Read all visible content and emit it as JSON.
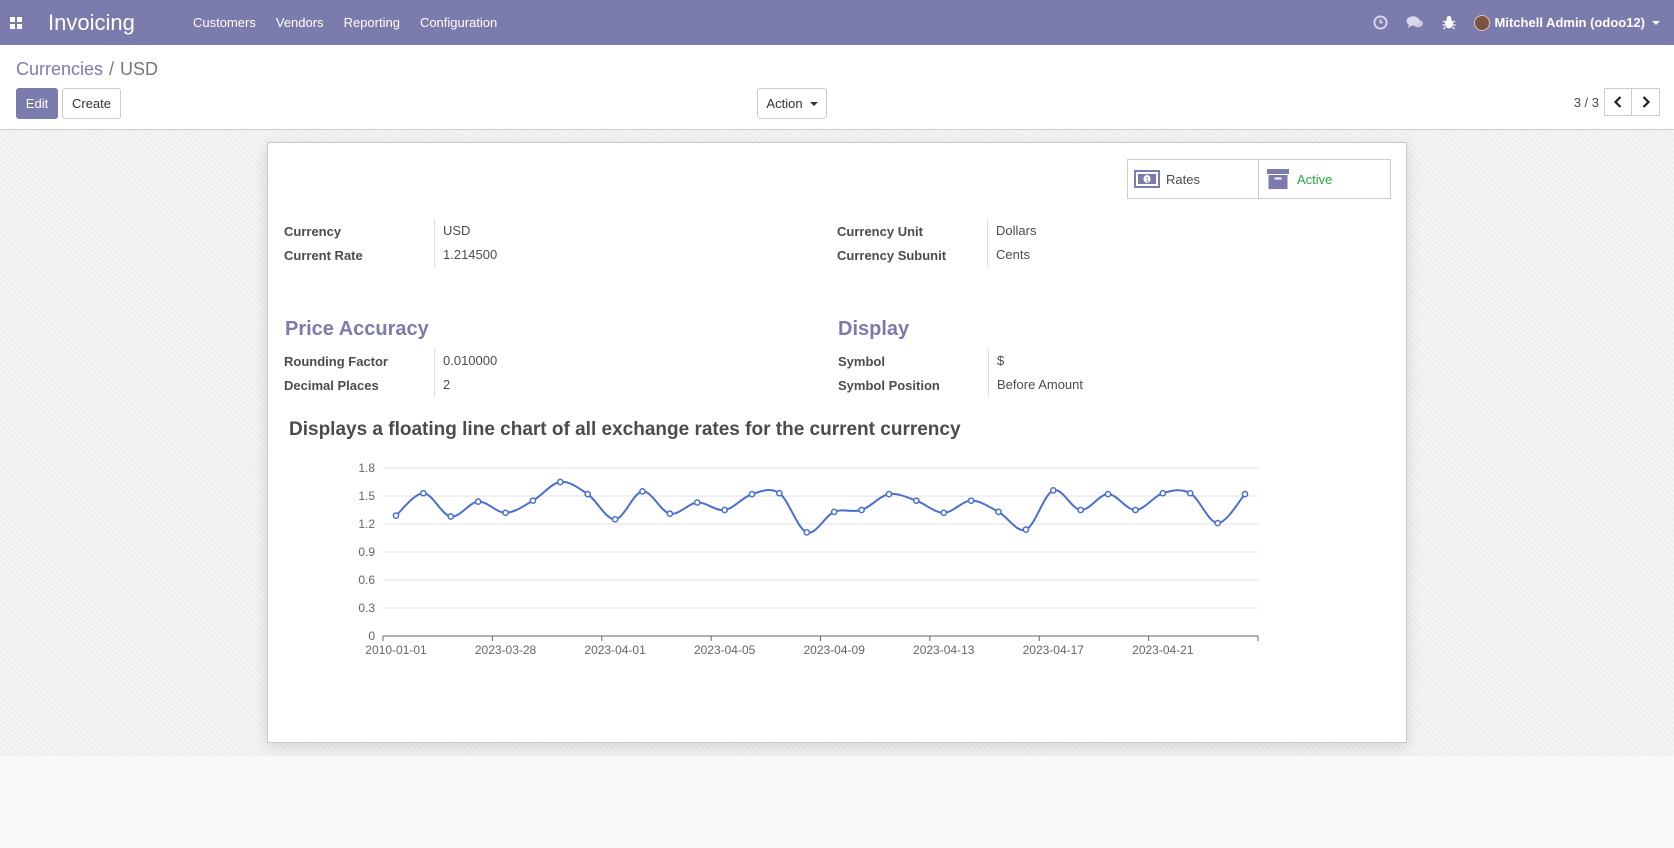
{
  "navbar": {
    "brand": "Invoicing",
    "menu": [
      "Customers",
      "Vendors",
      "Reporting",
      "Configuration"
    ],
    "user": "Mitchell Admin (odoo12)",
    "color": "#7c7bad"
  },
  "breadcrumb": {
    "parent": "Currencies",
    "separator": "/",
    "current": "USD"
  },
  "buttons": {
    "edit": "Edit",
    "create": "Create",
    "action": "Action"
  },
  "pager": {
    "value": "3 / 3"
  },
  "stat_buttons": {
    "rates": "Rates",
    "active": "Active"
  },
  "fields": {
    "currency_label": "Currency",
    "currency_value": "USD",
    "rate_label": "Current Rate",
    "rate_value": "1.214500",
    "unit_label": "Currency Unit",
    "unit_value": "Dollars",
    "subunit_label": "Currency Subunit",
    "subunit_value": "Cents"
  },
  "price_accuracy": {
    "title": "Price Accuracy",
    "rounding_label": "Rounding Factor",
    "rounding_value": "0.010000",
    "decimal_label": "Decimal Places",
    "decimal_value": "2"
  },
  "display": {
    "title": "Display",
    "symbol_label": "Symbol",
    "symbol_value": "$",
    "position_label": "Symbol Position",
    "position_value": "Before Amount"
  },
  "chart_heading": "Displays a floating line chart of all exchange rates for the current currency",
  "chart_data": {
    "type": "line",
    "x_ticks": [
      "2010-01-01",
      "2023-03-28",
      "2023-04-01",
      "2023-04-05",
      "2023-04-09",
      "2023-04-13",
      "2023-04-17",
      "2023-04-21"
    ],
    "y_ticks": [
      "0",
      "0.3",
      "0.6",
      "0.9",
      "1.2",
      "1.5",
      "1.8"
    ],
    "ylim": [
      0,
      1.8
    ],
    "grid": true,
    "color": "#4a6fd1",
    "values": [
      1.29,
      1.53,
      1.28,
      1.44,
      1.32,
      1.45,
      1.65,
      1.52,
      1.25,
      1.55,
      1.31,
      1.43,
      1.35,
      1.52,
      1.53,
      1.11,
      1.33,
      1.35,
      1.52,
      1.45,
      1.32,
      1.45,
      1.33,
      1.14,
      1.56,
      1.35,
      1.52,
      1.35,
      1.53,
      1.53,
      1.21,
      1.52
    ]
  }
}
